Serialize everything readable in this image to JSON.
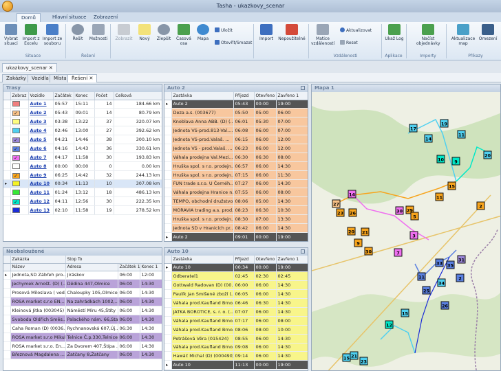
{
  "window": {
    "title": "Tasha - ukazkovy_scenar"
  },
  "ribbon_tabs": [
    {
      "label": "Domů",
      "active": true
    },
    {
      "label": "Hlavní situace",
      "active": false
    },
    {
      "label": "Zobrazení",
      "active": false
    }
  ],
  "ribbon": {
    "buttons": {
      "vybrat": "Vybrat situaci",
      "import_excel": "Import z Excelu",
      "import_soubor": "Import ze souboru",
      "resit": "Řešit",
      "moznosti": "Možnosti",
      "zobrazit": "Zobrazit",
      "novy": "Nový",
      "zlepsit": "Zlepšit",
      "casova_osa": "Časová osa",
      "mapa": "Mapa",
      "ulozit": "Uložit",
      "otevrit_smazat": "Otevřít/Smazat",
      "import": "Import",
      "nepouzitelne": "Nepoužitelné",
      "matice": "Matice vzdáleností",
      "aktualizovat": "Aktualizovat",
      "reset": "Reset",
      "ukaz_log": "Ukaž Log",
      "nacist": "Načíst objednávky",
      "aktualizace_map": "Aktualizace map",
      "omezeni": "Omezení"
    },
    "groups": {
      "situace": "Situace",
      "reseni": "Řešení",
      "vzdalenosti": "Vzdálenosti",
      "aplikace": "Aplikace",
      "importy": "Importy",
      "prikazy": "Příkazy"
    }
  },
  "doc_tab": {
    "label": "ukazkovy_scenar"
  },
  "sub_tabs": [
    "Zakázky",
    "Vozidla",
    "Místa",
    "Řešení"
  ],
  "trasy": {
    "title": "Trasy",
    "headers": [
      "Zobraz",
      "Vozidlo",
      "Začátek",
      "Konec",
      "Počet",
      "Celková"
    ],
    "rows": [
      {
        "vozidlo": "Auto 1",
        "zacatek": "05:57",
        "konec": "15:11",
        "pocet": "14",
        "celkova": "184.66 km",
        "color": "#f07e7e",
        "checked": false
      },
      {
        "vozidlo": "Auto 2",
        "zacatek": "05:43",
        "konec": "09:01",
        "pocet": "14",
        "celkova": "80.79 km",
        "color": "#f9c287",
        "checked": true
      },
      {
        "vozidlo": "Auto 3",
        "zacatek": "03:38",
        "konec": "13:22",
        "pocet": "37",
        "celkova": "320.07 km",
        "color": "#fdfd7e",
        "checked": false
      },
      {
        "vozidlo": "Auto 4",
        "zacatek": "02:46",
        "konec": "13:00",
        "pocet": "27",
        "celkova": "392.62 km",
        "color": "#4fd0f0",
        "checked": false
      },
      {
        "vozidlo": "Auto 5",
        "zacatek": "04:21",
        "konec": "14:46",
        "pocet": "38",
        "celkova": "300.10 km",
        "color": "#9a86d8",
        "checked": true
      },
      {
        "vozidlo": "Auto 6",
        "zacatek": "04:16",
        "konec": "14:43",
        "pocet": "36",
        "celkova": "330.61 km",
        "color": "#5a80e0",
        "checked": true
      },
      {
        "vozidlo": "Auto 7",
        "zacatek": "04:17",
        "konec": "11:58",
        "pocet": "30",
        "celkova": "193.83 km",
        "color": "#ef6ff0",
        "checked": true
      },
      {
        "vozidlo": "Auto 8",
        "zacatek": "00:00",
        "konec": "00:00",
        "pocet": "0",
        "celkova": "0.00 km",
        "color": "#ffffff",
        "checked": false
      },
      {
        "vozidlo": "Auto 9",
        "zacatek": "06:25",
        "konec": "14:42",
        "pocet": "32",
        "celkova": "244.13 km",
        "color": "#f7a41c",
        "checked": true
      },
      {
        "vozidlo": "Auto 10",
        "zacatek": "00:34",
        "konec": "11:13",
        "pocet": "10",
        "celkova": "307.08 km",
        "color": "#f4f226",
        "checked": false
      },
      {
        "vozidlo": "Auto 11",
        "zacatek": "01:24",
        "konec": "13:12",
        "pocet": "18",
        "celkova": "486.13 km",
        "color": "#34e834",
        "checked": false
      },
      {
        "vozidlo": "Auto 12",
        "zacatek": "04:11",
        "konec": "12:56",
        "pocet": "30",
        "celkova": "222.35 km",
        "color": "#00e8c8",
        "checked": true
      },
      {
        "vozidlo": "Auto 13",
        "zacatek": "02:10",
        "konec": "11:58",
        "pocet": "19",
        "celkova": "278.52 km",
        "color": "#1b2cd8",
        "checked": false
      }
    ]
  },
  "auto2": {
    "title": "Auto 2",
    "headers": [
      "Zastávka",
      "Příjezd",
      "Otevřeno",
      "Zavřeno 1"
    ],
    "rows": [
      {
        "z": "Auto 2",
        "p": "05:43",
        "o": "00:00",
        "c": "19:00",
        "style": "dark"
      },
      {
        "z": "Deza a.s. (003677)",
        "p": "05:50",
        "o": "05:00",
        "c": "06:00",
        "style": "orange"
      },
      {
        "z": "Knoblava Anna ABB. (D) (...",
        "p": "06:01",
        "o": "05:30",
        "c": "07:00",
        "style": "orange"
      },
      {
        "z": "Jednota VS-prod.813-Val....",
        "p": "06:08",
        "o": "06:00",
        "c": "07:00",
        "style": "orange"
      },
      {
        "z": "Jednota VS-prod.Valaš. ...",
        "p": "06:15",
        "o": "06:00",
        "c": "12:00",
        "style": "orange"
      },
      {
        "z": "Jednota VS - prod.Valaš. ...",
        "p": "06:23",
        "o": "06:00",
        "c": "12:00",
        "style": "orange"
      },
      {
        "z": "Váhala prodejna Val.Mezi...",
        "p": "06:30",
        "o": "06:30",
        "c": "08:00",
        "style": "orange"
      },
      {
        "z": "Hruška spol. s r.o. prodejn...",
        "p": "06:57",
        "o": "06:00",
        "c": "14:30",
        "style": "orange"
      },
      {
        "z": "Hruška spol. s r.o. prodejn...",
        "p": "07:15",
        "o": "06:00",
        "c": "11:30",
        "style": "orange"
      },
      {
        "z": "FUN trade s.r.o. U Černéh...",
        "p": "07:27",
        "o": "06:00",
        "c": "14:30",
        "style": "orange"
      },
      {
        "z": "Váhala prodejna Hranice n...",
        "p": "07:55",
        "o": "06:00",
        "c": "08:00",
        "style": "orange"
      },
      {
        "z": "TEMPO, obchodní družstvo...",
        "p": "08:06",
        "o": "05:00",
        "c": "14:30",
        "style": "orange"
      },
      {
        "z": "MORAVIA trading a.s. prod...",
        "p": "08:23",
        "o": "06:30",
        "c": "10:30",
        "style": "orange"
      },
      {
        "z": "Hruška spol. s r.o. prodejn...",
        "p": "08:30",
        "o": "07:00",
        "c": "13:30",
        "style": "orange"
      },
      {
        "z": "Jednota SD v Hranicích pr...",
        "p": "08:42",
        "o": "06:00",
        "c": "14:30",
        "style": "orange"
      },
      {
        "z": "Auto 2",
        "p": "09:01",
        "o": "00:00",
        "c": "19:00",
        "style": "dark"
      }
    ]
  },
  "mapa": {
    "title": "Mapa 1"
  },
  "nevobsluzene": {
    "title": "Neobsloužené",
    "group_headers": [
      "Zakázka",
      "Stop To"
    ],
    "headers": [
      "Název",
      "Adresa",
      "Začátek 1",
      "Konec 1"
    ],
    "rows": [
      {
        "n": "Jednota,SD Zábřeh pro...",
        "a": "Jiráskov",
        "s": "06:00",
        "k": "12:00",
        "color": "#ffffff"
      },
      {
        "n": "Jechymek Arnošt. (D) (...",
        "a": "Dědina 447,Olmice",
        "s": "06:00",
        "k": "14:30",
        "color": "#b9a3d9"
      },
      {
        "n": "Prosová Miloslava ( ved...",
        "a": "Chaloupky 105,Olmice",
        "s": "06:00",
        "k": "14:30",
        "color": "#ffffff"
      },
      {
        "n": "ROSA market s.r.o EN...",
        "a": "Na zahrádkách 1002,...",
        "s": "06:00",
        "k": "14:30",
        "color": "#b9a3d9"
      },
      {
        "n": "Kleinová Jitka (003045)",
        "a": "Náměstí Míru 45,Štíty",
        "s": "06:00",
        "k": "14:30",
        "color": "#ffffff"
      },
      {
        "n": "Svoboda Oldřich Směs...",
        "a": "Palackého nám. 66,Sta...",
        "s": "06:00",
        "k": "14:30",
        "color": "#b9a3d9"
      },
      {
        "n": "Caha Roman (D) (0036...",
        "a": "Rychnanovská 607,Új...",
        "s": "06:30",
        "k": "14:30",
        "color": "#ffffff"
      },
      {
        "n": "ROSA market s.r.o Mikulově...",
        "a": "Telnice Č.p.330,Telnice",
        "s": "06:00",
        "k": "14:30",
        "color": "#b9a3d9"
      },
      {
        "n": "ROSA market s.r.o. En...",
        "a": "Za Dvorem 407,Štípa ...",
        "s": "06:00",
        "k": "14:30",
        "color": "#ffffff"
      },
      {
        "n": "Březnová Magdalena ...",
        "a": "Žatčany 8,Žatčany",
        "s": "06:00",
        "k": "14:30",
        "color": "#b9a3d9"
      }
    ]
  },
  "auto10": {
    "title": "Auto 10",
    "headers": [
      "Zastávka",
      "Příjezd",
      "Otevřeno",
      "Zavřeno 1"
    ],
    "rows": [
      {
        "z": "Auto 10",
        "p": "00:34",
        "o": "00:00",
        "c": "19:00",
        "style": "dark"
      },
      {
        "z": "Odberatel1",
        "p": "02:45",
        "o": "02:30",
        "c": "02:45",
        "style": "yellow"
      },
      {
        "z": "Gottwald Radovan (D) (00...",
        "p": "06:00",
        "o": "06:00",
        "c": "14:30",
        "style": "yellow"
      },
      {
        "z": "Paulík Jan Smíšené zboží (...",
        "p": "06:05",
        "o": "06:00",
        "c": "14:30",
        "style": "yellow"
      },
      {
        "z": "Váhala prod.Kaufland Brno...",
        "p": "06:46",
        "o": "06:30",
        "c": "14:30",
        "style": "yellow"
      },
      {
        "z": "JATKA BOROTICE, s. r. o. (...",
        "p": "07:07",
        "o": "06:00",
        "c": "14:30",
        "style": "yellow"
      },
      {
        "z": "Váhala prod.Kaufland Brno...",
        "p": "07:17",
        "o": "06:00",
        "c": "08:00",
        "style": "yellow"
      },
      {
        "z": "Váhala prod.Kaufland Brno...",
        "p": "08:06",
        "o": "08:00",
        "c": "10:00",
        "style": "yellow"
      },
      {
        "z": "Petrášová Věra (015424)",
        "p": "08:55",
        "o": "06:00",
        "c": "14:30",
        "style": "yellow"
      },
      {
        "z": "Váhala prod.Kaufland Brno...",
        "p": "09:08",
        "o": "06:00",
        "c": "14:30",
        "style": "yellow"
      },
      {
        "z": "Hawáč Michal (D) (000490)",
        "p": "09:14",
        "o": "06:00",
        "c": "14:30",
        "style": "yellow"
      },
      {
        "z": "Auto 10",
        "p": "11:13",
        "o": "00:00",
        "c": "19:00",
        "style": "dark"
      }
    ]
  },
  "map_markers": [
    {
      "n": "17",
      "c": "#4fd0f0"
    },
    {
      "n": "19",
      "c": "#4fd0f0"
    },
    {
      "n": "14",
      "c": "#4fd0f0"
    },
    {
      "n": "11",
      "c": "#4fd0f0"
    },
    {
      "n": "10",
      "c": "#00e8c8"
    },
    {
      "n": "9",
      "c": "#00e8c8"
    },
    {
      "n": "20",
      "c": "#4fd0f0"
    },
    {
      "n": "27",
      "c": "#f9c287"
    },
    {
      "n": "14",
      "c": "#ef6ff0"
    },
    {
      "n": "23",
      "c": "#f7a41c"
    },
    {
      "n": "26",
      "c": "#f7a41c"
    },
    {
      "n": "29",
      "c": "#f7a41c"
    },
    {
      "n": "30",
      "c": "#ef6ff0"
    },
    {
      "n": "11",
      "c": "#f7a41c"
    },
    {
      "n": "15",
      "c": "#f7a41c"
    },
    {
      "n": "20",
      "c": "#f7a41c"
    },
    {
      "n": "21",
      "c": "#f7a41c"
    },
    {
      "n": "7",
      "c": "#ef6ff0"
    },
    {
      "n": "3",
      "c": "#ef6ff0"
    },
    {
      "n": "31",
      "c": "#9a86d8"
    },
    {
      "n": "33",
      "c": "#5a80e0"
    },
    {
      "n": "35",
      "c": "#5a80e0"
    },
    {
      "n": "11",
      "c": "#5a80e0"
    },
    {
      "n": "34",
      "c": "#4fd0f0"
    },
    {
      "n": "25",
      "c": "#5a80e0"
    },
    {
      "n": "26",
      "c": "#5a80e0"
    },
    {
      "n": "15",
      "c": "#4fd0f0"
    },
    {
      "n": "12",
      "c": "#00e8c8"
    },
    {
      "n": "30",
      "c": "#f7a41c"
    },
    {
      "n": "2",
      "c": "#f7a41c"
    },
    {
      "n": "9",
      "c": "#f7a41c"
    },
    {
      "n": "5",
      "c": "#f7a41c"
    },
    {
      "n": "2",
      "c": "#5a80e0"
    },
    {
      "n": "21",
      "c": "#4fd0f0"
    },
    {
      "n": "15",
      "c": "#4fd0f0"
    },
    {
      "n": "23",
      "c": "#4fd0f0"
    }
  ]
}
